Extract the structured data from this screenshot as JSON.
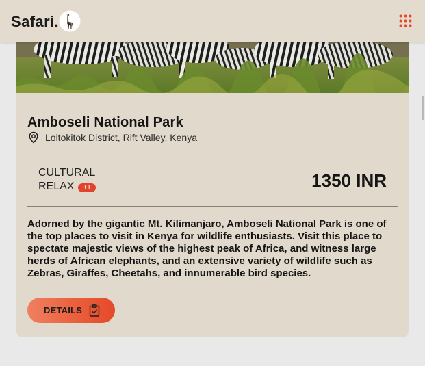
{
  "header": {
    "logo_text": "Safari.",
    "logo_icon": "giraffe-icon",
    "menu_icon": "grid-menu-icon"
  },
  "card": {
    "image_alt": "zebras grazing",
    "title": "Amboseli National Park",
    "location_icon": "map-pin-icon",
    "location": "Loitokitok District, Rift Valley, Kenya",
    "tags": [
      "CULTURAL",
      "RELAX"
    ],
    "extra_tags_badge": "+1",
    "price": "1350 INR",
    "description": "Adorned by the gigantic Mt. Kilimanjaro, Amboseli National Park is one of the top places to visit in Kenya for wildlife enthusiasts. Visit this place to spectate majestic views of the highest peak of Africa, and witness large herds of African elephants, and an extensive variety of wildlife such as Zebras, Giraffes, Cheetahs, and innumerable bird species.",
    "details_label": "DETAILS",
    "details_icon": "clipboard-check-icon"
  },
  "colors": {
    "accent": "#e5492a",
    "card_bg": "#e1d9cb",
    "header_bg": "#e3dbcd",
    "page_bg": "#e9e9e9"
  }
}
